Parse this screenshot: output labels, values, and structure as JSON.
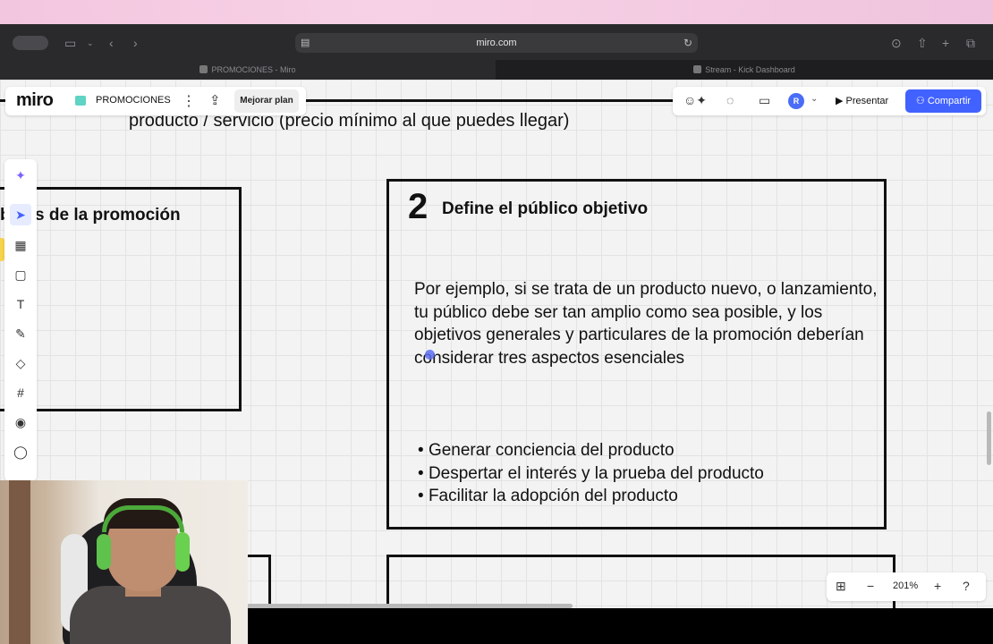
{
  "menubar": {
    "apple_icon": "apple-logo-icon"
  },
  "browser": {
    "url": "miro.com",
    "tabs": [
      {
        "label": "PROMOCIONES - Miro",
        "active": true
      },
      {
        "label": "Stream - Kick Dashboard",
        "active": false
      }
    ]
  },
  "miro": {
    "logo": "miro",
    "board_name": "PROMOCIONES",
    "upgrade_label": "Mejorar plan",
    "present_label": "Presentar",
    "share_label": "Compartir",
    "avatar_initial": "R",
    "zoom_level": "201%"
  },
  "board": {
    "partial_text": "producto / servicio (precio mínimo al que puedes llegar)",
    "left_frame_title": "b  vos de la promoción",
    "main_frame": {
      "number": "2",
      "title": "Define el público objetivo",
      "paragraph": "Por ejemplo, si se trata de un producto nuevo, o lanzamiento, tu público debe ser tan amplio como sea posible, y los objetivos generales y particulares de la promoción deberían considerar tres aspectos esenciales",
      "bullets": [
        "Generar conciencia del producto",
        "Despertar el interés y la prueba del producto",
        "Facilitar la adopción del producto"
      ]
    }
  },
  "colors": {
    "accent": "#4262ff",
    "board_bg": "#f3f3f3",
    "board_icon": "#5fd3c4"
  }
}
